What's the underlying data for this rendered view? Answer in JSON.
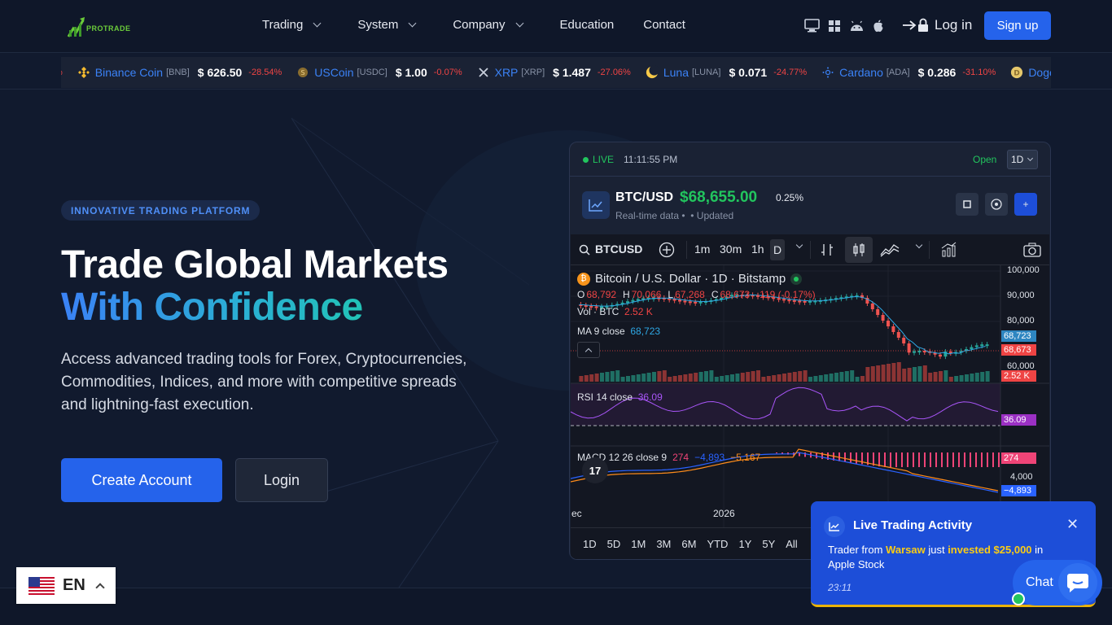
{
  "header": {
    "logo_text": "PROTRADE",
    "nav": [
      {
        "label": "Trading",
        "dropdown": true
      },
      {
        "label": "System",
        "dropdown": true
      },
      {
        "label": "Company",
        "dropdown": true
      },
      {
        "label": "Education",
        "dropdown": false
      },
      {
        "label": "Contact",
        "dropdown": false
      }
    ],
    "platform_icons": [
      "desktop-icon",
      "windows-icon",
      "android-icon",
      "apple-icon"
    ],
    "login_label": "Log in",
    "signup_label": "Sign up"
  },
  "ticker": [
    {
      "name": "Binance Coin",
      "symbol": "[BNB]",
      "price": "$ 626.50",
      "change": "-28.54%",
      "icon": "bnb-icon"
    },
    {
      "name": "USCoin",
      "symbol": "[USDC]",
      "price": "$ 1.00",
      "change": "-0.07%",
      "icon": "usdc-icon"
    },
    {
      "name": "XRP",
      "symbol": "[XRP]",
      "price": "$ 1.487",
      "change": "-27.06%",
      "icon": "xrp-icon"
    },
    {
      "name": "Luna",
      "symbol": "[LUNA]",
      "price": "$ 0.071",
      "change": "-24.77%",
      "icon": "luna-icon"
    },
    {
      "name": "Cardano",
      "symbol": "[ADA]",
      "price": "$ 0.286",
      "change": "-31.10%",
      "icon": "cardano-icon"
    },
    {
      "name": "Dogecoin",
      "symbol": "",
      "price": "",
      "change": "",
      "icon": "dogecoin-icon"
    }
  ],
  "ticker_leading_fragment": "%",
  "hero": {
    "badge": "INNOVATIVE TRADING PLATFORM",
    "title_line1": "Trade Global Markets",
    "title_line2": "With Confidence",
    "lead": "Access advanced trading tools for Forex, Cryptocurrencies, Commodities, Indices, and more with competitive spreads and lightning-fast execution.",
    "create_label": "Create Account",
    "login_label": "Login"
  },
  "panel": {
    "live": "LIVE",
    "time": "11:11:55 PM",
    "status": "Open",
    "timeframe": "1D",
    "pair": "BTC/USD",
    "price": "$68,655.00",
    "change": "0.25%",
    "sub_realtime": "Real-time data",
    "sub_updated": "Updated",
    "add_label": "+"
  },
  "tv": {
    "symbol": "BTCUSD",
    "intervals": [
      "1m",
      "30m",
      "1h",
      "D"
    ],
    "legend_title": "Bitcoin / U.S. Dollar · 1D · Bitstamp",
    "ohlc": {
      "o": "68,792",
      "h": "70,066",
      "l": "67,268",
      "c": "68,673",
      "chg": "-119 (-0.17%)"
    },
    "vol_label": "Vol · BTC",
    "vol_value": "2.52 K",
    "ma_label": "MA 9 close",
    "ma_value": "68,723",
    "rsi_label": "RSI 14 close",
    "rsi_value": "36.09",
    "macd_label": "MACD 12 26 close 9",
    "macd_values": [
      "274",
      "−4,893",
      "−5,167"
    ],
    "y_ticks": [
      "100,000",
      "90,000",
      "80,000",
      "60,000"
    ],
    "x_ticks": [
      "ec",
      "2026"
    ],
    "tags": {
      "ma": "68,723",
      "price": "68,673",
      "vol": "2.52 K",
      "rsi": "36.09",
      "macd": "274",
      "signal": "−4,893",
      "macd_axis": "4,000"
    },
    "ranges": [
      "1D",
      "5D",
      "1M",
      "3M",
      "6M",
      "YTD",
      "1Y",
      "5Y",
      "All"
    ]
  },
  "notification": {
    "title": "Live Trading Activity",
    "text_prefix": "Trader from",
    "city": "Warsaw",
    "text_mid": "just",
    "action": "invested $25,000",
    "text_suffix": "in Apple Stock",
    "time": "23:11"
  },
  "chat": {
    "label": "Chat"
  },
  "language": {
    "code": "EN"
  },
  "colors": {
    "accent": "#2563eb",
    "up": "#22c55e",
    "down": "#ef4444",
    "highlight": "#facc15"
  }
}
